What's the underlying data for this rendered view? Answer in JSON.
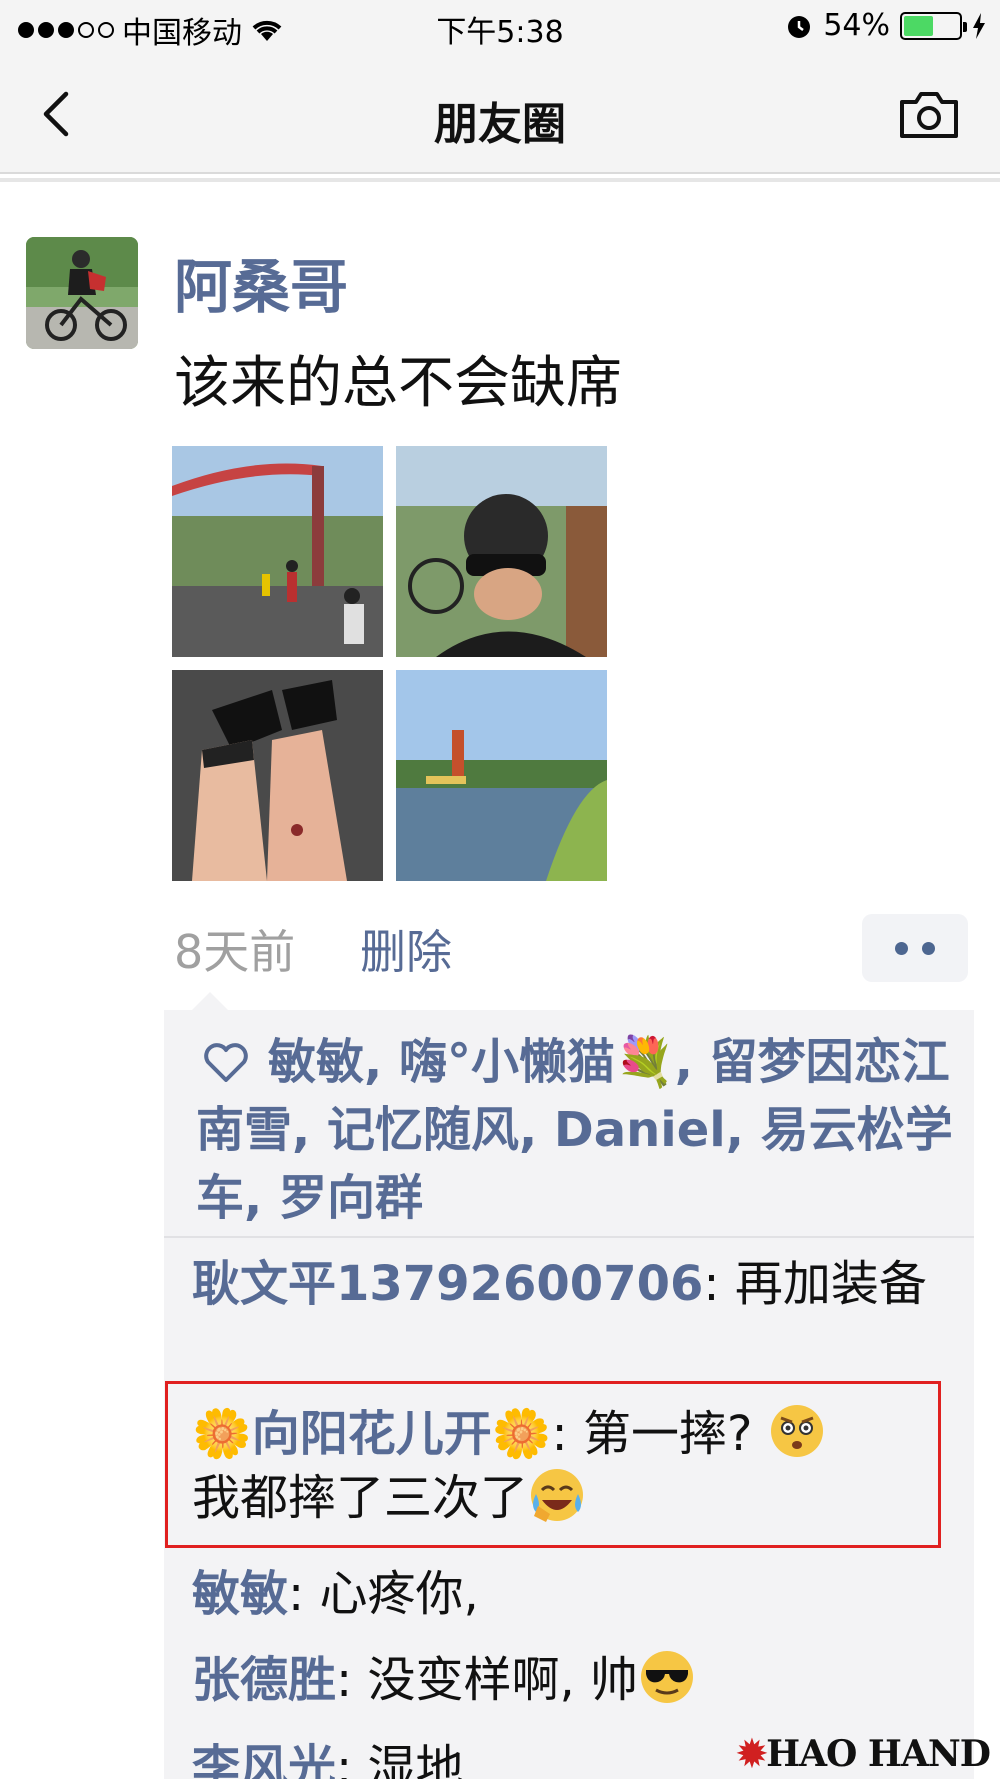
{
  "status_bar": {
    "carrier": "中国移动",
    "time": "下午5:38",
    "battery_percent": "54%",
    "battery_level": 0.54
  },
  "nav": {
    "title": "朋友圈",
    "back_icon": "chevron-left-icon",
    "camera_icon": "camera-icon"
  },
  "post": {
    "author": "阿桑哥",
    "text": "该来的总不会缺席",
    "time_ago": "8天前",
    "delete_label": "删除"
  },
  "likes": {
    "names": [
      "敏敏",
      "嗨°小懒猫💐",
      "留梦因恋江南雪",
      "记忆随风",
      "Daniel",
      "易云松学车",
      "罗向群"
    ],
    "text": "敏敏, 嗨°小懒猫💐, 留梦因恋江南雪, 记忆随风, Daniel, 易云松学车, 罗向群"
  },
  "comments": [
    {
      "name": "耿文平13792600706",
      "text": ": 再加装备"
    },
    {
      "name": "🌼向阳花儿开🌼",
      "text": ": 第一摔? ",
      "text2": "我都摔了三次了"
    },
    {
      "name": "敏敏",
      "text": ": 心疼你,"
    },
    {
      "name": "张德胜",
      "text": ": 没变样啊, 帅"
    },
    {
      "name": "李风光",
      "text": ": 湿地"
    }
  ],
  "colors": {
    "link": "#576b95",
    "highlight_border": "#e02020",
    "battery": "#4cd964"
  },
  "watermark": "HAO HAND"
}
